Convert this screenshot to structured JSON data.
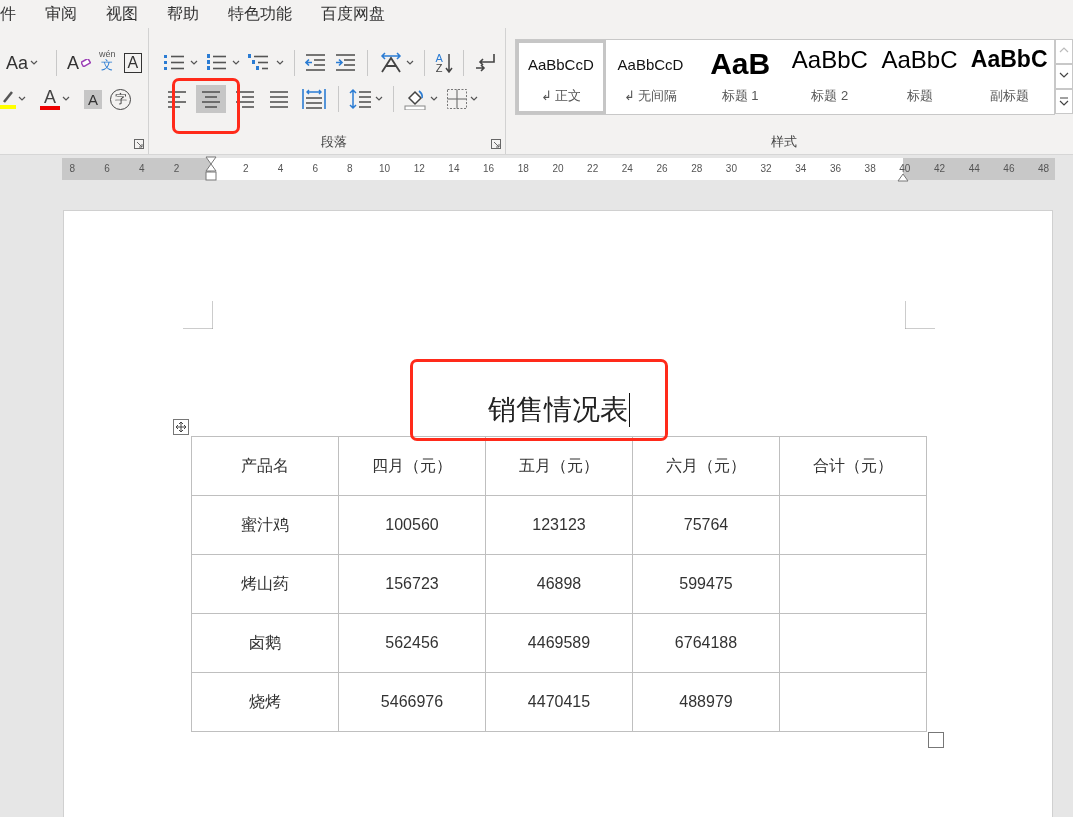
{
  "menu": [
    {
      "label": "件"
    },
    {
      "label": "审阅"
    },
    {
      "label": "视图"
    },
    {
      "label": "帮助"
    },
    {
      "label": "特色功能"
    },
    {
      "label": "百度网盘"
    }
  ],
  "font_group": {
    "row1": [
      {
        "kind": "change-case",
        "glyph": "Aa"
      },
      {
        "kind": "separator"
      },
      {
        "kind": "clear-format",
        "glyph": "A"
      },
      {
        "kind": "phonetic",
        "glyph": "wén",
        "sub": "文"
      },
      {
        "kind": "boxed",
        "glyph": "A"
      }
    ],
    "row2": [
      {
        "kind": "highlight"
      },
      {
        "kind": "font-color",
        "glyph": "A"
      },
      {
        "kind": "shaded",
        "glyph": "A"
      },
      {
        "kind": "enclosed",
        "glyph": "字"
      }
    ]
  },
  "paragraph": {
    "label": "段落",
    "row1": [
      {
        "kind": "bullets"
      },
      {
        "kind": "numbering"
      },
      {
        "kind": "multilevel"
      },
      {
        "kind": "separator"
      },
      {
        "kind": "outdent"
      },
      {
        "kind": "indent"
      },
      {
        "kind": "separator"
      },
      {
        "kind": "text-direction"
      },
      {
        "kind": "separator"
      },
      {
        "kind": "sort",
        "glyph": "A",
        "sub": "Z"
      },
      {
        "kind": "separator"
      },
      {
        "kind": "show-marks"
      }
    ],
    "row2": [
      {
        "kind": "align-left",
        "selected": false
      },
      {
        "kind": "align-center",
        "selected": true
      },
      {
        "kind": "align-right",
        "selected": false
      },
      {
        "kind": "justify",
        "selected": false
      },
      {
        "kind": "distribute",
        "selected": false
      },
      {
        "kind": "separator"
      },
      {
        "kind": "line-spacing"
      },
      {
        "kind": "separator"
      },
      {
        "kind": "shading"
      },
      {
        "kind": "borders"
      }
    ]
  },
  "styles": {
    "label": "样式",
    "items": [
      {
        "kind": "body",
        "preview": "AaBbCcD",
        "mark": "↲",
        "name": "正文",
        "selected": true
      },
      {
        "kind": "no-spacing",
        "preview": "AaBbCcD",
        "mark": "↲",
        "name": "无间隔",
        "selected": false
      },
      {
        "kind": "heading1",
        "preview": "AaB",
        "name": "标题 1",
        "selected": false
      },
      {
        "kind": "heading2",
        "preview": "AaBbC",
        "name": "标题 2",
        "selected": false
      },
      {
        "kind": "title",
        "preview": "AaBbC",
        "name": "标题",
        "selected": false
      },
      {
        "kind": "subtitle",
        "preview": "AaBbC",
        "name": "副标题",
        "selected": false
      }
    ]
  },
  "ruler": {
    "left_labels": [
      "8",
      "6",
      "4",
      "2"
    ],
    "right_labels": [
      "2",
      "4",
      "6",
      "8",
      "10",
      "12",
      "14",
      "16",
      "18",
      "20",
      "22",
      "24",
      "26",
      "28",
      "30",
      "32",
      "34",
      "36",
      "38",
      "40",
      "42",
      "44",
      "46",
      "48"
    ]
  },
  "document": {
    "title": "销售情况表",
    "table": {
      "columns": [
        "产品名",
        "四月（元）",
        "五月（元）",
        "六月（元）",
        "合计（元）"
      ],
      "rows": [
        [
          "蜜汁鸡",
          "100560",
          "123123",
          "75764"
        ],
        [
          "烤山药",
          "156723",
          "46898",
          "599475"
        ],
        [
          "卤鹅",
          "562456",
          "4469589",
          "6764188"
        ],
        [
          "烧烤",
          "5466976",
          "4470415",
          "488979"
        ]
      ]
    }
  },
  "annotations": [
    {
      "kind": "highlight-box"
    },
    {
      "kind": "highlight-box"
    }
  ]
}
